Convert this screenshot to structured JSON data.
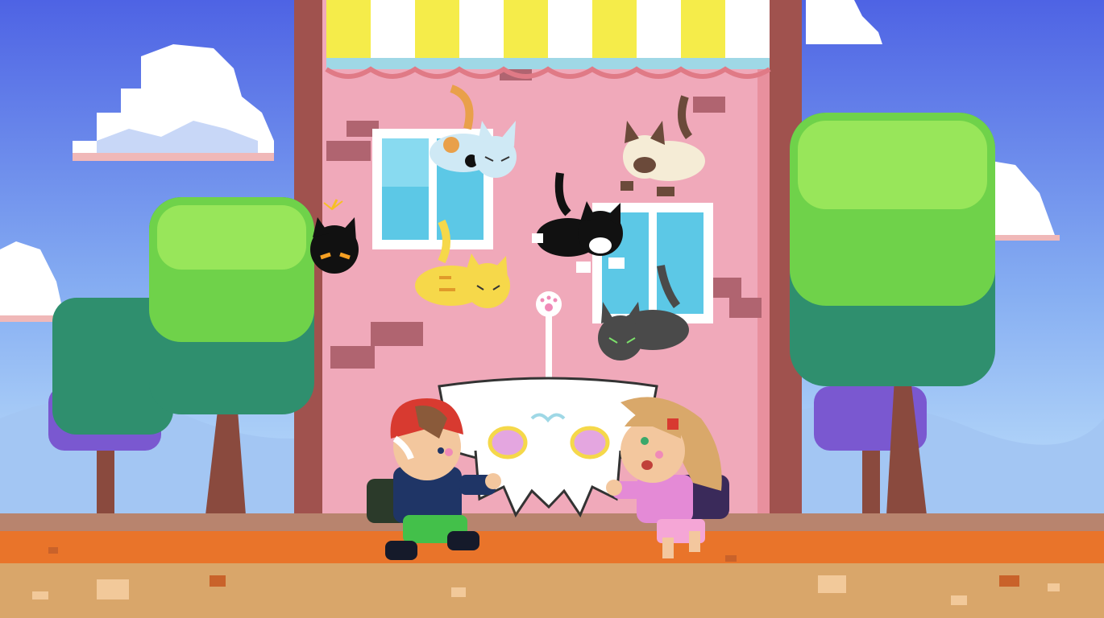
{
  "scene": {
    "sky_colors": [
      "#5468e6",
      "#8fb4f0",
      "#bfe0fa"
    ],
    "building_color": "#f0a9ba",
    "awning_colors": [
      "#f5ec4a",
      "#ffffff"
    ],
    "ground_colors": [
      "#e9742a",
      "#d9a66a"
    ]
  },
  "characters": {
    "boy": {
      "hat_color": "#d83a30",
      "jacket_color": "#1f3566",
      "pants_color": "#43c04a"
    },
    "girl": {
      "hair_color": "#d9a86a",
      "shirt_color": "#e48ad6",
      "bag_color": "#3a2a5a"
    },
    "umbrella": {
      "color": "#ffffff",
      "handle_ornament": "paw-icon"
    }
  },
  "cats": [
    {
      "name": "calico",
      "color": "#cfe9f5"
    },
    {
      "name": "siamese",
      "color": "#f5ecd6"
    },
    {
      "name": "tuxedo",
      "color": "#111111"
    },
    {
      "name": "orange-tabby",
      "color": "#f6d84a"
    },
    {
      "name": "gray",
      "color": "#4a4a4a"
    },
    {
      "name": "bomb-cat",
      "color": "#111111"
    }
  ]
}
